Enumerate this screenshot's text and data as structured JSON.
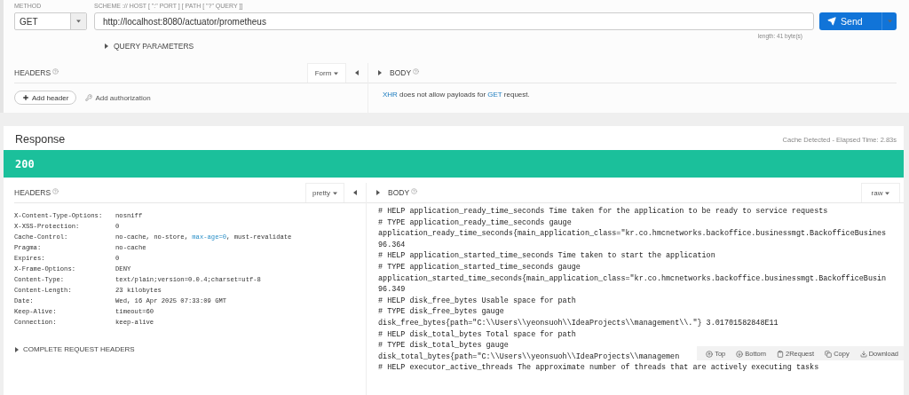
{
  "request": {
    "method_label": "METHOD",
    "method": "GET",
    "url_label": "SCHEME :// HOST [ \":\" PORT ] [ PATH [ \"?\" QUERY ]]",
    "url": "http://localhost:8080/actuator/prometheus",
    "length": "length: 41 byte(s)",
    "send_label": "Send",
    "query_parameters_label": "QUERY PARAMETERS"
  },
  "request_headers": {
    "title": "HEADERS",
    "mode": "Form",
    "add_header": "Add header",
    "add_authorization": "Add authorization"
  },
  "request_body": {
    "title": "BODY",
    "message": [
      {
        "text": "XHR",
        "kind": "highlight"
      },
      {
        "text": " does not allow payloads for ",
        "kind": "plain"
      },
      {
        "text": "GET",
        "kind": "highlight"
      },
      {
        "text": " request.",
        "kind": "plain"
      }
    ]
  },
  "response": {
    "title": "Response",
    "cache_info": "Cache Detected - Elapsed Time: 2.83s",
    "status": "200",
    "headers_title": "HEADERS",
    "headers_format": "pretty",
    "headers": [
      {
        "name": "X-Content-Type-Options:",
        "value": [
          {
            "text": "nosniff",
            "kind": "plain"
          }
        ]
      },
      {
        "name": "X-XSS-Protection:",
        "value": [
          {
            "text": "0",
            "kind": "plain"
          }
        ]
      },
      {
        "name": "Cache-Control:",
        "value": [
          {
            "text": "no-cache, no-store, ",
            "kind": "plain"
          },
          {
            "text": "max-age=0",
            "kind": "highlight"
          },
          {
            "text": ", must-revalidate",
            "kind": "plain"
          }
        ]
      },
      {
        "name": "Pragma:",
        "value": [
          {
            "text": "no-cache",
            "kind": "plain"
          }
        ]
      },
      {
        "name": "Expires:",
        "value": [
          {
            "text": "0",
            "kind": "plain"
          }
        ]
      },
      {
        "name": "X-Frame-Options:",
        "value": [
          {
            "text": "DENY",
            "kind": "plain"
          }
        ]
      },
      {
        "name": "Content-Type:",
        "value": [
          {
            "text": "text/plain;version=0.0.4;charset=utf-8",
            "kind": "plain"
          }
        ]
      },
      {
        "name": "Content-Length:",
        "value": [
          {
            "text": "23 kilobytes",
            "kind": "plain"
          }
        ]
      },
      {
        "name": "Date:",
        "value": [
          {
            "text": "Wed, 16 Apr 2025 07:33:09 GMT",
            "kind": "plain"
          }
        ]
      },
      {
        "name": "Keep-Alive:",
        "value": [
          {
            "text": "timeout=60",
            "kind": "plain"
          }
        ]
      },
      {
        "name": "Connection:",
        "value": [
          {
            "text": "keep-alive",
            "kind": "plain"
          }
        ]
      }
    ],
    "complete_request_headers": "COMPLETE REQUEST HEADERS",
    "body_title": "BODY",
    "body_format": "raw",
    "body_lines": [
      "# HELP application_ready_time_seconds Time taken for the application to be ready to service requests",
      "# TYPE application_ready_time_seconds gauge",
      "application_ready_time_seconds{main_application_class=\"kr.co.hmcnetworks.backoffice.businessmgt.BackofficeBusines",
      "96.364",
      "# HELP application_started_time_seconds Time taken to start the application",
      "# TYPE application_started_time_seconds gauge",
      "application_started_time_seconds{main_application_class=\"kr.co.hmcnetworks.backoffice.businessmgt.BackofficeBusin",
      "96.349",
      "# HELP disk_free_bytes Usable space for path",
      "# TYPE disk_free_bytes gauge",
      "disk_free_bytes{path=\"C:\\\\Users\\\\yeonsuoh\\\\IdeaProjects\\\\management\\\\.\"} 3.01701582848E11",
      "# HELP disk_total_bytes Total space for path",
      "# TYPE disk_total_bytes gauge",
      "disk_total_bytes{path=\"C:\\\\Users\\\\yeonsuoh\\\\IdeaProjects\\\\managemen",
      "# HELP executor_active_threads The approximate number of threads that are actively executing tasks"
    ],
    "toolbar": [
      {
        "label": "Top",
        "kind": "top"
      },
      {
        "label": "Bottom",
        "kind": "bottom"
      },
      {
        "label": "2Request",
        "kind": "request"
      },
      {
        "label": "Copy",
        "kind": "copy"
      },
      {
        "label": "Download",
        "kind": "download"
      }
    ]
  }
}
